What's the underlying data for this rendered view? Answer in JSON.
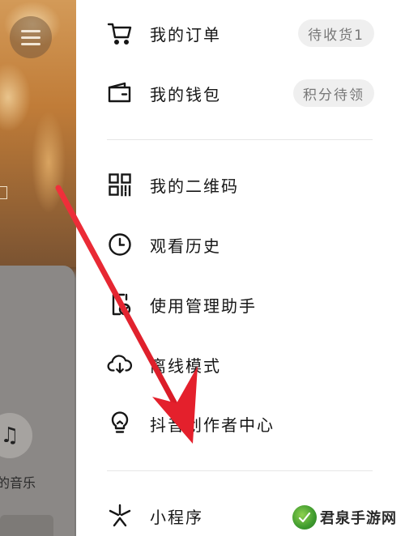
{
  "left_panel": {
    "music_label": "的音乐",
    "music_icon": "music-note-icon",
    "menu_icon": "hamburger-menu-icon"
  },
  "drawer": {
    "items": [
      {
        "label": "我的订单",
        "icon": "cart-icon",
        "badge": "待收货1"
      },
      {
        "label": "我的钱包",
        "icon": "wallet-icon",
        "badge": "积分待领"
      },
      {
        "label": "我的二维码",
        "icon": "qr-code-icon"
      },
      {
        "label": "观看历史",
        "icon": "clock-icon"
      },
      {
        "label": "使用管理助手",
        "icon": "phone-manager-icon"
      },
      {
        "label": "离线模式",
        "icon": "cloud-download-icon"
      },
      {
        "label": "抖音创作者中心",
        "icon": "lightbulb-icon"
      },
      {
        "label": "小程序",
        "icon": "mini-program-icon"
      }
    ]
  },
  "annotation": {
    "arrow_color": "#e8222f",
    "target": "抖音创作者中心"
  },
  "watermark": {
    "text": "君泉手游网"
  }
}
